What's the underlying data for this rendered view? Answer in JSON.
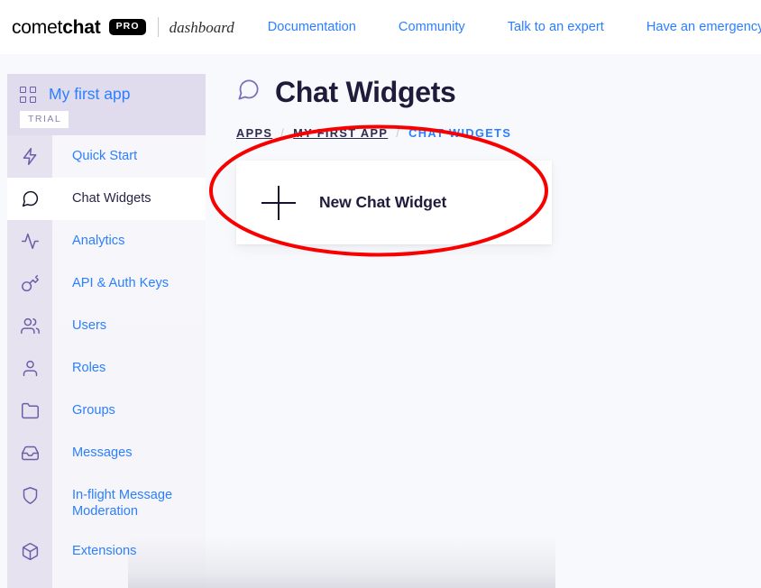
{
  "topbar": {
    "brand_light": "comet",
    "brand_bold": "chat",
    "pro_badge": "PRO",
    "sub_label": "dashboard",
    "nav": [
      {
        "label": "Documentation",
        "name": "nav-documentation"
      },
      {
        "label": "Community",
        "name": "nav-community"
      },
      {
        "label": "Talk to an expert",
        "name": "nav-talk-to-an-expert"
      },
      {
        "label": "Have an emergency?",
        "name": "nav-have-an-emergency"
      }
    ]
  },
  "sidebar": {
    "app_name": "My first app",
    "plan_badge": "TRIAL",
    "items": [
      {
        "label": "Quick Start",
        "icon": "bolt-icon",
        "active": false
      },
      {
        "label": "Chat Widgets",
        "icon": "chat-bubble-icon",
        "active": true
      },
      {
        "label": "Analytics",
        "icon": "pulse-icon",
        "active": false
      },
      {
        "label": "API & Auth Keys",
        "icon": "key-icon",
        "active": false
      },
      {
        "label": "Users",
        "icon": "users-icon",
        "active": false
      },
      {
        "label": "Roles",
        "icon": "user-icon",
        "active": false
      },
      {
        "label": "Groups",
        "icon": "folder-icon",
        "active": false
      },
      {
        "label": "Messages",
        "icon": "inbox-icon",
        "active": false
      },
      {
        "label": "In-flight Message\nModeration",
        "icon": "shield-icon",
        "active": false
      },
      {
        "label": "Extensions",
        "icon": "cube-icon",
        "active": false
      }
    ]
  },
  "main": {
    "title": "Chat Widgets",
    "title_icon": "chat-bubble-icon",
    "breadcrumb": {
      "items": [
        "APPS",
        "MY FIRST APP",
        "CHAT WIDGETS"
      ],
      "separator": "/"
    },
    "new_widget_card": {
      "label": "New Chat Widget",
      "icon": "plus-icon"
    }
  },
  "annotation": {
    "shape": "ellipse",
    "color": "#f90000",
    "target": "New Chat Widget"
  },
  "colors": {
    "link_blue": "#2b7fff",
    "heading_navy": "#211b3b",
    "sidebar_lavender": "#e6e2f0",
    "sidebar_header": "#e0dcee",
    "icon_purple": "#6a5fa8",
    "page_bg": "#f8f9fc",
    "annotation_red": "#f90000"
  }
}
